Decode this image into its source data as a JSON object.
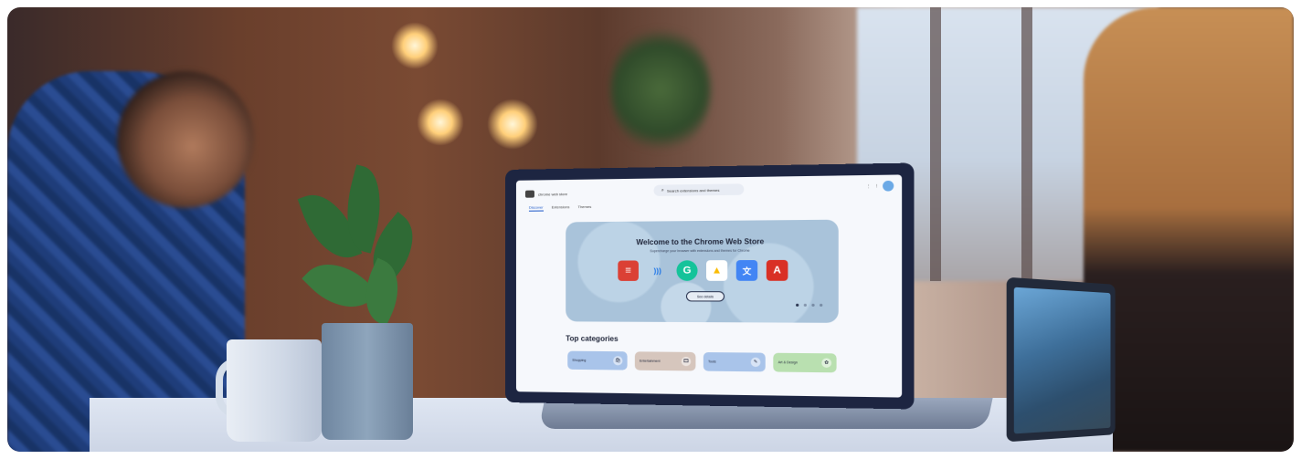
{
  "scene": {
    "description_colors": {
      "accent": "#1a56c8",
      "hero_bg": "#a9c3da",
      "screen_bg": "#f6f8fc"
    },
    "laptop_screen": {
      "store_name": "chrome web store",
      "search_placeholder": "Search extensions and themes",
      "search_icon": "search-icon",
      "top_right_icons": [
        "more-icon",
        "apps-icon",
        "avatar"
      ],
      "nav_tabs": [
        "Discover",
        "Extensions",
        "Themes"
      ],
      "active_tab": "Discover",
      "hero": {
        "title": "Welcome to the Chrome Web Store",
        "subtitle": "Supercharge your browser with extensions and themes for Chrome",
        "extensions": [
          {
            "name": "todoist-icon",
            "glyph": "≡",
            "color": "#db4035"
          },
          {
            "name": "read-aloud-icon",
            "glyph": ")))",
            "color": "#1a73e8"
          },
          {
            "name": "grammarly-icon",
            "glyph": "G",
            "color": "#15c39a"
          },
          {
            "name": "google-drive-icon",
            "glyph": "▲",
            "color": "#fbbc04"
          },
          {
            "name": "google-translate-icon",
            "glyph": "文",
            "color": "#4285f4"
          },
          {
            "name": "adobe-acrobat-icon",
            "glyph": "A",
            "color": "#d93025"
          }
        ],
        "button": "See details"
      },
      "top_categories_title": "Top categories",
      "categories": [
        {
          "label": "Shopping",
          "color": "#a9c4ea",
          "icon": "🛍"
        },
        {
          "label": "Entertainment",
          "color": "#d6c6bd",
          "icon": "🎞"
        },
        {
          "label": "Tools",
          "color": "#a9c4ea",
          "icon": "✎"
        },
        {
          "label": "Art & Design",
          "color": "#b9e0b0",
          "icon": "✿"
        }
      ]
    }
  }
}
